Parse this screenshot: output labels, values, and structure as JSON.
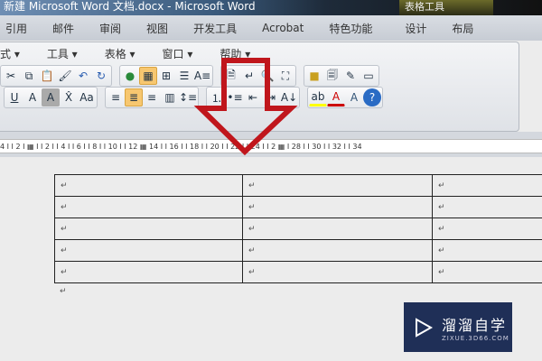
{
  "window": {
    "title": "新建 Microsoft Word 文档.docx - Microsoft Word",
    "context_tab": "表格工具"
  },
  "ribbon_tabs": [
    "引用",
    "邮件",
    "审阅",
    "视图",
    "开发工具",
    "Acrobat",
    "特色功能",
    "设计",
    "布局"
  ],
  "menu": [
    "式 ▾",
    "工具 ▾",
    "表格 ▾",
    "窗口 ▾",
    "帮助 ▾"
  ],
  "ruler": "4 I  I 2 I  ▦ I  I 2 I  I 4 I  I 6 I  I 8 I  I 10 I  I 12 ▦ 14 I  I 16 I  I 18 I  I 20 I  I 22 I  I 24 I  I 2 ▦ I 28 I  I 30 I  I 32 I  I 34",
  "table": {
    "rows": [
      [
        "↵",
        "↵",
        "↵"
      ],
      [
        "↵",
        "↵",
        "↵"
      ],
      [
        "↵",
        "↵",
        "↵"
      ],
      [
        "↵",
        "↵",
        "↵"
      ],
      [
        "↵",
        "↵",
        "↵"
      ]
    ]
  },
  "paragraph_mark": "↵",
  "watermark": {
    "name": "溜溜自学",
    "url": "ZIXUE.3D66.COM"
  },
  "colors": {
    "arrow": "#c0161c",
    "highlight": "#f7c770"
  }
}
